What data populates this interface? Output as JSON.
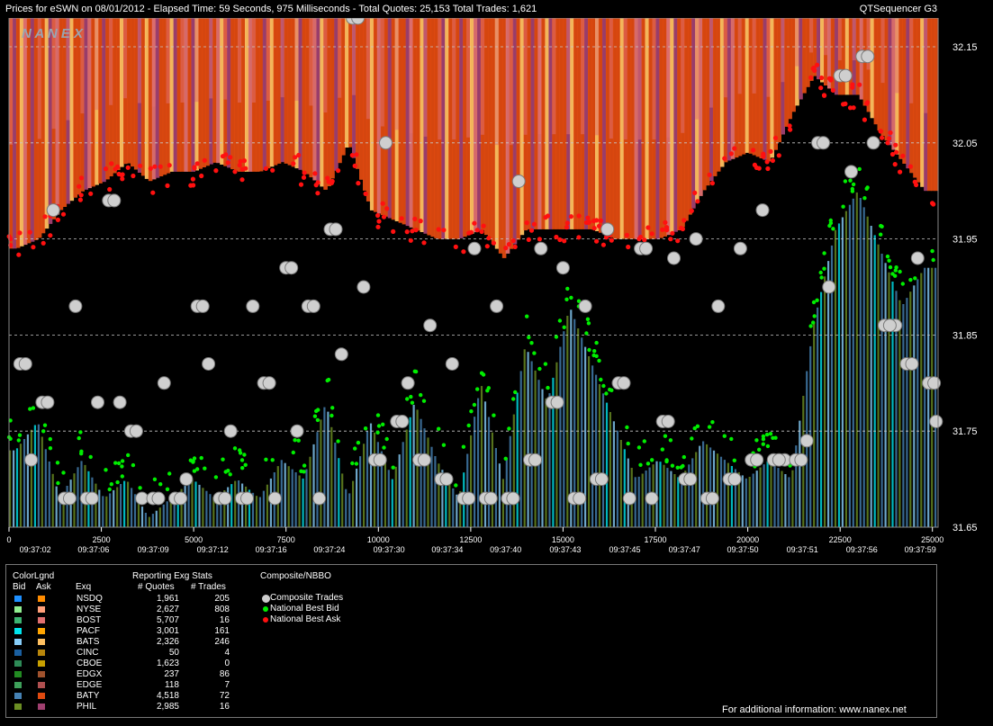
{
  "title": {
    "left": "Prices for  eSWN  on  08/01/2012  -  Elapsed Time: 59 Seconds, 975 Milliseconds  -  Total Quotes: 25,153  Total Trades: 1,621",
    "right": "QTSequencer G3"
  },
  "watermark": "N A N E X",
  "chart_data": {
    "type": "scatter",
    "y_ticks": [
      "32.15",
      "32.05",
      "31.95",
      "31.85",
      "31.75",
      "31.65"
    ],
    "y_tick_values": [
      32.15,
      32.05,
      31.95,
      31.85,
      31.75,
      31.65
    ],
    "ylim": [
      31.65,
      32.18
    ],
    "x_ticks": [
      "0",
      "2500",
      "5000",
      "7500",
      "10000",
      "12500",
      "15000",
      "17500",
      "20000",
      "22500",
      "25000"
    ],
    "x_tick_values": [
      0,
      2500,
      5000,
      7500,
      10000,
      12500,
      15000,
      17500,
      20000,
      22500,
      25000
    ],
    "xlim": [
      0,
      25153
    ],
    "time_labels": [
      "09:37:02",
      "09:37:06",
      "09:37:09",
      "09:37:12",
      "09:37:16",
      "09:37:24",
      "09:37:30",
      "09:37:34",
      "09:37:40",
      "09:37:43",
      "09:37:45",
      "09:37:47",
      "09:37:50",
      "09:37:51",
      "09:37:56",
      "09:37:59"
    ],
    "time_label_x": [
      1100,
      3550,
      6050,
      8550,
      11000,
      13450,
      15950,
      18400,
      20850,
      23350,
      25850,
      28350,
      30800,
      33300,
      35800,
      38250
    ],
    "grid": true,
    "trades_sample": [
      [
        300,
        31.82
      ],
      [
        600,
        31.72
      ],
      [
        900,
        31.78
      ],
      [
        1200,
        31.98
      ],
      [
        1500,
        31.68
      ],
      [
        1800,
        31.88
      ],
      [
        2100,
        31.68
      ],
      [
        2400,
        31.78
      ],
      [
        2700,
        31.99
      ],
      [
        3000,
        31.78
      ],
      [
        3300,
        31.75
      ],
      [
        3600,
        31.68
      ],
      [
        3900,
        31.68
      ],
      [
        4200,
        31.8
      ],
      [
        4500,
        31.68
      ],
      [
        4800,
        31.7
      ],
      [
        5100,
        31.88
      ],
      [
        5400,
        31.82
      ],
      [
        5700,
        31.68
      ],
      [
        6000,
        31.75
      ],
      [
        6300,
        31.68
      ],
      [
        6600,
        31.88
      ],
      [
        6900,
        31.8
      ],
      [
        7200,
        31.68
      ],
      [
        7500,
        31.92
      ],
      [
        7800,
        31.75
      ],
      [
        8100,
        31.88
      ],
      [
        8400,
        31.68
      ],
      [
        8700,
        31.96
      ],
      [
        9000,
        31.83
      ],
      [
        9300,
        32.18
      ],
      [
        9600,
        31.9
      ],
      [
        9900,
        31.72
      ],
      [
        10200,
        32.05
      ],
      [
        10500,
        31.76
      ],
      [
        10800,
        31.8
      ],
      [
        11100,
        31.72
      ],
      [
        11400,
        31.86
      ],
      [
        11700,
        31.7
      ],
      [
        12000,
        31.82
      ],
      [
        12300,
        31.68
      ],
      [
        12600,
        31.94
      ],
      [
        12900,
        31.68
      ],
      [
        13200,
        31.88
      ],
      [
        13500,
        31.68
      ],
      [
        13800,
        32.01
      ],
      [
        14100,
        31.72
      ],
      [
        14400,
        31.94
      ],
      [
        14700,
        31.78
      ],
      [
        15000,
        31.92
      ],
      [
        15300,
        31.68
      ],
      [
        15600,
        31.88
      ],
      [
        15900,
        31.7
      ],
      [
        16200,
        31.96
      ],
      [
        16500,
        31.8
      ],
      [
        16800,
        31.68
      ],
      [
        17100,
        31.94
      ],
      [
        17400,
        31.68
      ],
      [
        17700,
        31.76
      ],
      [
        18000,
        31.93
      ],
      [
        18300,
        31.7
      ],
      [
        18600,
        31.95
      ],
      [
        18900,
        31.68
      ],
      [
        19200,
        31.88
      ],
      [
        19500,
        31.7
      ],
      [
        19800,
        31.94
      ],
      [
        20100,
        31.72
      ],
      [
        20400,
        31.98
      ],
      [
        20700,
        31.72
      ],
      [
        21000,
        31.72
      ],
      [
        21300,
        31.72
      ],
      [
        21600,
        31.74
      ],
      [
        21900,
        32.05
      ],
      [
        22200,
        31.9
      ],
      [
        22500,
        32.12
      ],
      [
        22800,
        32.02
      ],
      [
        23100,
        32.14
      ],
      [
        23400,
        32.05
      ],
      [
        23700,
        31.86
      ],
      [
        24000,
        31.86
      ],
      [
        24300,
        31.82
      ],
      [
        24600,
        31.93
      ],
      [
        24900,
        31.8
      ],
      [
        25100,
        31.76
      ]
    ],
    "bid_sample": [
      [
        200,
        31.75
      ],
      [
        800,
        31.78
      ],
      [
        1400,
        31.7
      ],
      [
        2000,
        31.74
      ],
      [
        2600,
        31.7
      ],
      [
        3200,
        31.72
      ],
      [
        3800,
        31.68
      ],
      [
        4400,
        31.7
      ],
      [
        5000,
        31.72
      ],
      [
        5600,
        31.7
      ],
      [
        6200,
        31.72
      ],
      [
        6800,
        31.7
      ],
      [
        7400,
        31.74
      ],
      [
        8000,
        31.72
      ],
      [
        8600,
        31.8
      ],
      [
        9200,
        31.7
      ],
      [
        9800,
        31.78
      ],
      [
        10400,
        31.72
      ],
      [
        11000,
        31.8
      ],
      [
        11600,
        31.74
      ],
      [
        12200,
        31.7
      ],
      [
        12800,
        31.82
      ],
      [
        13400,
        31.72
      ],
      [
        14000,
        31.86
      ],
      [
        14600,
        31.8
      ],
      [
        15200,
        31.9
      ],
      [
        15800,
        31.84
      ],
      [
        16400,
        31.78
      ],
      [
        17000,
        31.72
      ],
      [
        17600,
        31.74
      ],
      [
        18200,
        31.72
      ],
      [
        18800,
        31.76
      ],
      [
        19400,
        31.74
      ],
      [
        20000,
        31.72
      ],
      [
        20600,
        31.74
      ],
      [
        21200,
        31.72
      ],
      [
        21800,
        31.88
      ],
      [
        22400,
        31.98
      ],
      [
        23000,
        32.02
      ],
      [
        23600,
        31.96
      ],
      [
        24200,
        31.9
      ],
      [
        24800,
        31.94
      ]
    ],
    "ask_sample": [
      [
        200,
        31.94
      ],
      [
        800,
        31.95
      ],
      [
        1400,
        31.98
      ],
      [
        2000,
        32.0
      ],
      [
        2600,
        32.01
      ],
      [
        3200,
        32.03
      ],
      [
        3800,
        32.01
      ],
      [
        4400,
        32.02
      ],
      [
        5000,
        32.02
      ],
      [
        5600,
        32.03
      ],
      [
        6200,
        32.02
      ],
      [
        6800,
        32.02
      ],
      [
        7400,
        32.03
      ],
      [
        8000,
        32.02
      ],
      [
        8600,
        32.0
      ],
      [
        9200,
        32.05
      ],
      [
        9800,
        31.98
      ],
      [
        10400,
        31.97
      ],
      [
        11000,
        31.96
      ],
      [
        11600,
        31.95
      ],
      [
        12200,
        31.95
      ],
      [
        12800,
        31.96
      ],
      [
        13400,
        31.93
      ],
      [
        14000,
        31.96
      ],
      [
        14600,
        31.96
      ],
      [
        15200,
        31.96
      ],
      [
        15800,
        31.96
      ],
      [
        16400,
        31.95
      ],
      [
        17000,
        31.95
      ],
      [
        17600,
        31.95
      ],
      [
        18200,
        31.96
      ],
      [
        18800,
        32.0
      ],
      [
        19400,
        32.03
      ],
      [
        20000,
        32.04
      ],
      [
        20600,
        32.03
      ],
      [
        21200,
        32.08
      ],
      [
        21800,
        32.12
      ],
      [
        22400,
        32.1
      ],
      [
        23000,
        32.1
      ],
      [
        23600,
        32.06
      ],
      [
        24200,
        32.03
      ],
      [
        24800,
        32.0
      ]
    ]
  },
  "legend": {
    "headers": {
      "color_legend": "ColorLgnd",
      "bid": "Bid",
      "ask": "Ask",
      "exq": "Exq",
      "reporting": "Reporting Exg Stats",
      "quotes": "# Quotes",
      "trades": "# Trades",
      "composite": "Composite/NBBO"
    },
    "rows": [
      {
        "exq": "NSDQ",
        "quotes": "1,961",
        "trades": "205",
        "bid_color": "#1e90ff",
        "ask_color": "#ff8c00"
      },
      {
        "exq": "NYSE",
        "quotes": "2,627",
        "trades": "808",
        "bid_color": "#90ee90",
        "ask_color": "#ffa07a"
      },
      {
        "exq": "BOST",
        "quotes": "5,707",
        "trades": "16",
        "bid_color": "#3cb371",
        "ask_color": "#e07070"
      },
      {
        "exq": "PACF",
        "quotes": "3,001",
        "trades": "161",
        "bid_color": "#00e5ee",
        "ask_color": "#ffa500"
      },
      {
        "exq": "BATS",
        "quotes": "2,326",
        "trades": "246",
        "bid_color": "#87cefa",
        "ask_color": "#ffc060"
      },
      {
        "exq": "CINC",
        "quotes": "50",
        "trades": "4",
        "bid_color": "#1a5fa0",
        "ask_color": "#b8860b"
      },
      {
        "exq": "CBOE",
        "quotes": "1,623",
        "trades": "0",
        "bid_color": "#2e8b57",
        "ask_color": "#c8a000"
      },
      {
        "exq": "EDGX",
        "quotes": "237",
        "trades": "86",
        "bid_color": "#228b22",
        "ask_color": "#a0522d"
      },
      {
        "exq": "EDGE",
        "quotes": "118",
        "trades": "7",
        "bid_color": "#3ea05a",
        "ask_color": "#b05050"
      },
      {
        "exq": "BATY",
        "quotes": "4,518",
        "trades": "72",
        "bid_color": "#4682b4",
        "ask_color": "#e04a10"
      },
      {
        "exq": "PHIL",
        "quotes": "2,985",
        "trades": "16",
        "bid_color": "#6b8e23",
        "ask_color": "#a04070"
      }
    ],
    "composite_items": [
      {
        "label": "Composite Trades",
        "color": "#cccccc"
      },
      {
        "label": "National Best Bid",
        "color": "#00ee00"
      },
      {
        "label": "National Best Ask",
        "color": "#ff1010"
      }
    ],
    "footer": "For additional information: www.nanex.net"
  }
}
